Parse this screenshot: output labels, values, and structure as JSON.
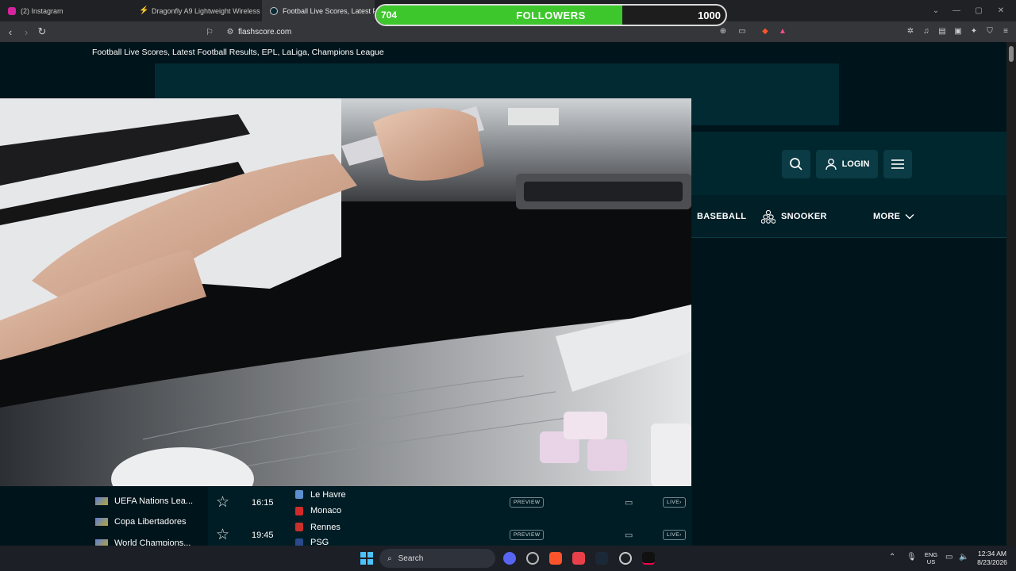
{
  "browser": {
    "tabs": [
      {
        "label": "(2) Instagram",
        "active": false,
        "icon": "instagram-icon",
        "color": "#d6249f"
      },
      {
        "label": "Dragonfly A9 Lightweight Wireless M",
        "active": false,
        "icon": "dragonfly-icon",
        "color": "#e08a2c"
      },
      {
        "label": "Football Live Scores, Latest Foot",
        "active": true,
        "icon": "flashscore-icon",
        "color": "#ff0046"
      }
    ],
    "url": "flashscore.com"
  },
  "overlay": {
    "current": "704",
    "label": "FOLLOWERS",
    "goal": "1000",
    "progress": 0.704,
    "fill_color": "#3ec72d"
  },
  "page": {
    "title": "Football Live Scores, Latest Football Results, EPL, LaLiga, Champions League",
    "login_label": "LOGIN",
    "sports": [
      "BASEBALL",
      "SNOOKER",
      "MORE"
    ]
  },
  "leagues": [
    "UEFA Nations Lea...",
    "Copa Libertadores",
    "World Champions..."
  ],
  "matches": [
    {
      "time": "16:15",
      "home": "Le Havre",
      "away": "Monaco",
      "status": "PREVIEW",
      "live": "LIVE"
    },
    {
      "time": "19:45",
      "home": "Rennes",
      "away": "PSG",
      "status": "PREVIEW",
      "live": "LIVE"
    }
  ],
  "taskbar": {
    "search_placeholder": "Search",
    "lang": "ENG",
    "region": "US",
    "time": "12:34 AM",
    "date": "8/23/2026"
  }
}
